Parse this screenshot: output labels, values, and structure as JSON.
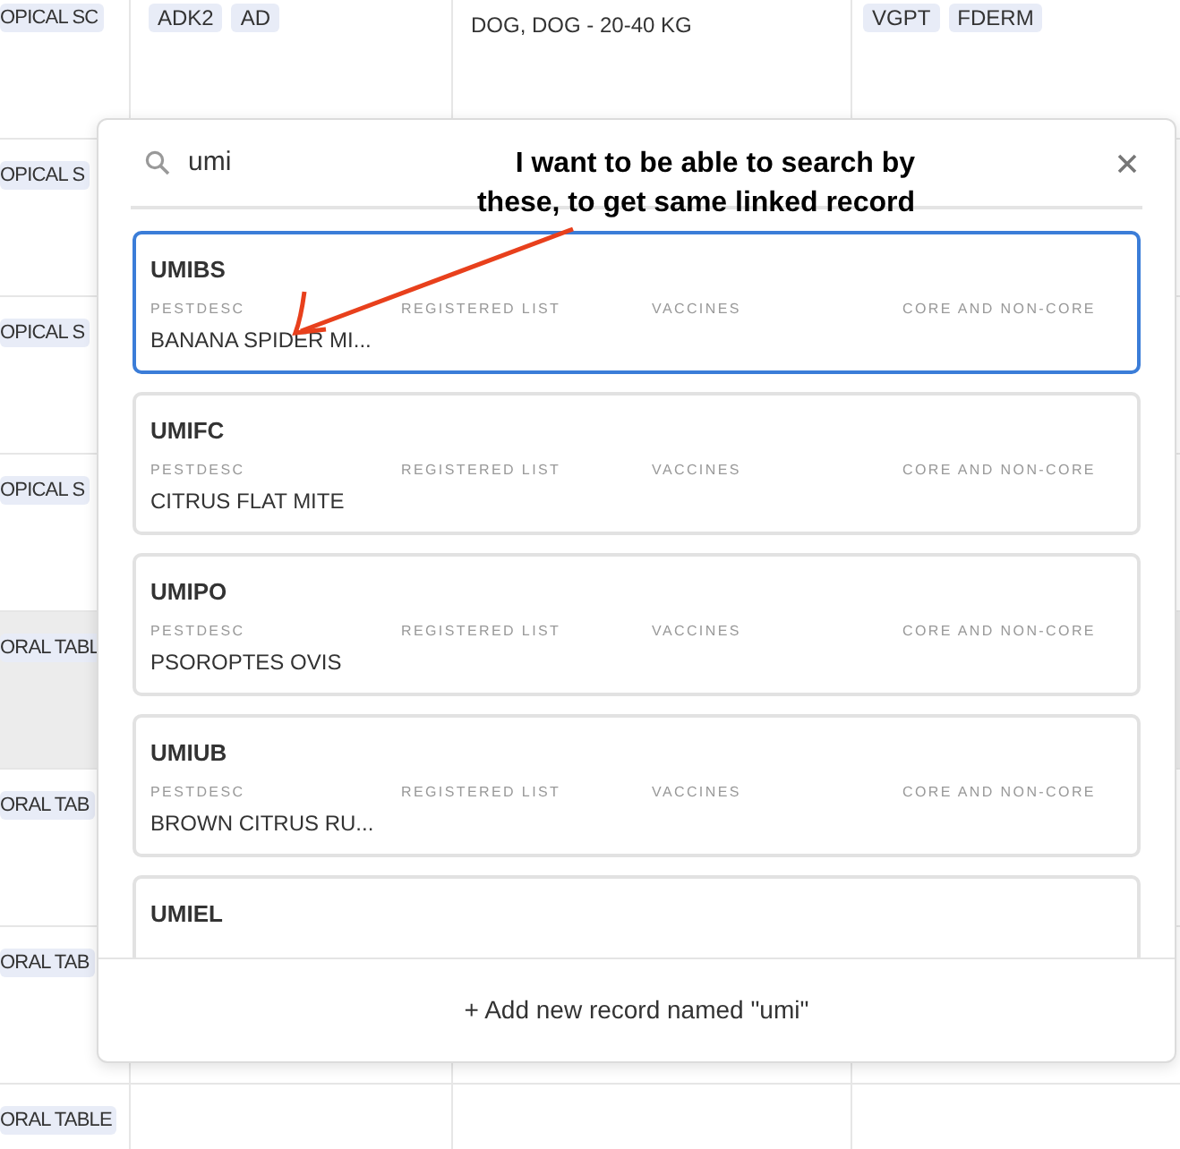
{
  "table": {
    "rows": [
      {
        "column_1": [
          "OPICAL SC"
        ],
        "column_2": [
          "ADK2",
          "AD"
        ],
        "column_3": "DOG, DOG - 20-40 KG",
        "column_4": [
          "VGPT",
          "FDERM"
        ],
        "selected": false
      },
      {
        "column_1": [
          "OPICAL S"
        ],
        "selected": false
      },
      {
        "column_1": [
          "OPICAL S"
        ],
        "selected": false
      },
      {
        "column_1": [
          "OPICAL S"
        ],
        "selected": false
      },
      {
        "column_1": [
          "ORAL TABL"
        ],
        "selected": true
      },
      {
        "column_1": [
          "ORAL TAB"
        ],
        "selected": false
      },
      {
        "column_1": [
          "ORAL TAB"
        ],
        "selected": false
      },
      {
        "column_1": [
          "ORAL TABLE"
        ],
        "selected": false
      }
    ]
  },
  "search_popup": {
    "search": {
      "value": "umi"
    },
    "results": [
      {
        "title": "UMIBS",
        "selected": true,
        "fields": [
          {
            "label": "PESTDESC",
            "value": "BANANA SPIDER MI..."
          },
          {
            "label": "REGISTERED LIST"
          },
          {
            "label": "VACCINES"
          },
          {
            "label": "CORE AND NON-CORE"
          }
        ]
      },
      {
        "title": "UMIFC",
        "selected": false,
        "fields": [
          {
            "label": "PESTDESC",
            "value": "CITRUS FLAT MITE"
          },
          {
            "label": "REGISTERED LIST"
          },
          {
            "label": "VACCINES"
          },
          {
            "label": "CORE AND NON-CORE"
          }
        ]
      },
      {
        "title": "UMIPO",
        "selected": false,
        "fields": [
          {
            "label": "PESTDESC",
            "value": "PSOROPTES OVIS"
          },
          {
            "label": "REGISTERED LIST"
          },
          {
            "label": "VACCINES"
          },
          {
            "label": "CORE AND NON-CORE"
          }
        ]
      },
      {
        "title": "UMIUB",
        "selected": false,
        "fields": [
          {
            "label": "PESTDESC",
            "value": "BROWN CITRUS RU..."
          },
          {
            "label": "REGISTERED LIST"
          },
          {
            "label": "VACCINES"
          },
          {
            "label": "CORE AND NON-CORE"
          }
        ]
      },
      {
        "title": "UMIEL",
        "selected": false
      }
    ],
    "add_button": "+ Add new record named \"umi\""
  },
  "annotation": {
    "lines": [
      "I want to be able to search by",
      "these, to get same linked record"
    ]
  }
}
